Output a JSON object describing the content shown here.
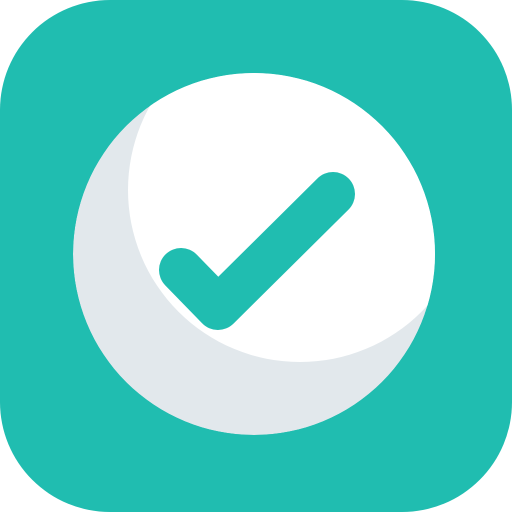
{
  "icon": {
    "name": "checkmark-app-icon",
    "colors": {
      "tile": "#20BDB0",
      "circle": "#FFFFFF",
      "circle_shadow": "#E2E8EC",
      "check": "#20BDB0",
      "check_shadow": "#1A9A8E"
    }
  }
}
